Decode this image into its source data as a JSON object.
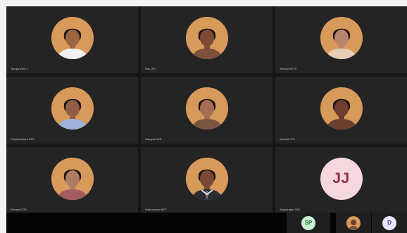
{
  "participants": [
    {
      "name": "Tanuja AWS 1",
      "type": "photo",
      "skin": "#9b6442",
      "hair": "#1f1713",
      "shirt": "#f0f0f0"
    },
    {
      "name": "Ruu (Pi)",
      "type": "photo",
      "skin": "#7d4a35",
      "hair": "#1a1412",
      "shirt": "#7e4f39"
    },
    {
      "name": "Jerisya SKTS",
      "type": "photo",
      "skin": "#b9856f",
      "hair": "#201512",
      "shirt": "#e7ccb5"
    },
    {
      "name": "Priyadarshani DOJ",
      "type": "photo",
      "skin": "#8f5e45",
      "hair": "#1c1512",
      "shirt": "#9eb1d8"
    },
    {
      "name": "Rangna DSS",
      "type": "photo",
      "skin": "#a56e52",
      "hair": "#1b1411",
      "shirt": "#7a5542"
    },
    {
      "name": "Ayravati ITS",
      "type": "photo",
      "skin": "#6e3f2f",
      "hair": "#1a1311",
      "shirt": "#6b3f2f"
    },
    {
      "name": "Kishani DOS",
      "type": "photo",
      "skin": "#b07d63",
      "hair": "#1b1412",
      "shirt": "#a45d5e"
    },
    {
      "name": "Hathunaran MKT",
      "type": "photo_suit",
      "skin": "#7a4a34",
      "hair": "#1a1411",
      "shirt": "#2a2d33"
    },
    {
      "name": "Jayasinghe JDS",
      "type": "initials",
      "initials": "JJ"
    }
  ],
  "thumbnails": [
    {
      "label": "SP",
      "type": "initials",
      "bg": "#c9f3d2",
      "fg": "#2f6f3e"
    },
    {
      "label": "",
      "type": "photo",
      "bg": "#d79a5b"
    },
    {
      "label": "D",
      "type": "initials",
      "bg": "#e8e3ff",
      "fg": "#4d3f9a"
    }
  ],
  "colors": {
    "meeting_bg": "#161616",
    "tile_bg": "#242424",
    "avatar_bg": "#d79a5b",
    "jj_bg": "#f6d7dd",
    "jj_fg": "#8e2f46"
  }
}
